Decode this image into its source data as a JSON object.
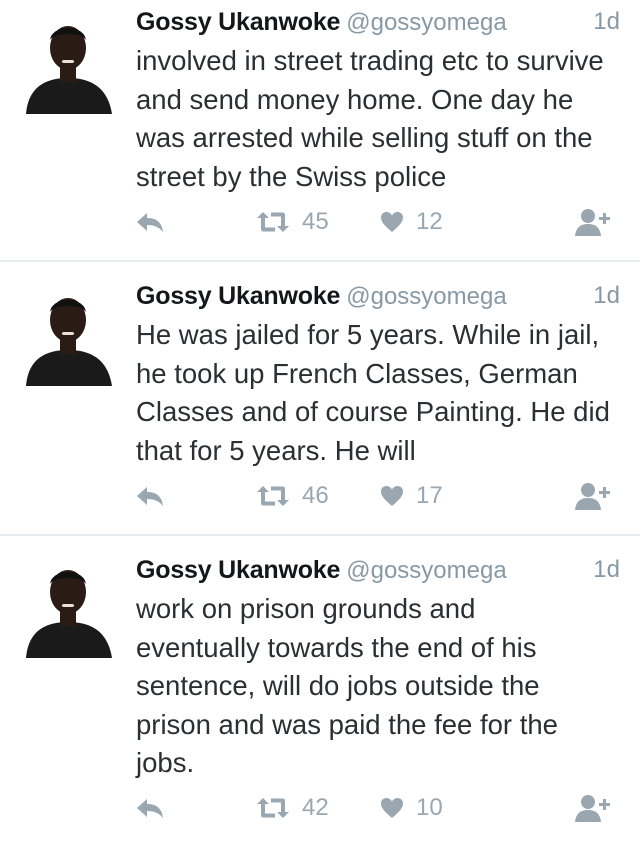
{
  "colors": {
    "name": "#14171a",
    "secondary": "#8899a6",
    "text": "#292f33",
    "icon": "#9aa7b1",
    "divider": "#e6ecf0"
  },
  "icons": {
    "reply": "reply-icon",
    "retweet": "retweet-icon",
    "like": "heart-icon",
    "follow": "follow-user-icon"
  },
  "tweets": [
    {
      "name": "Gossy Ukanwoke",
      "handle": "@gossyomega",
      "time": "1d",
      "lines": [
        "involved in street trading etc to survive",
        "and send money home. One day he",
        "was arrested while selling stuff on the",
        "street by the Swiss police"
      ],
      "retweets": "45",
      "likes": "12"
    },
    {
      "name": "Gossy Ukanwoke",
      "handle": "@gossyomega",
      "time": "1d",
      "lines": [
        "He was jailed for 5 years. While in jail,",
        "he took up French Classes, German",
        "Classes and of course Painting. He did",
        "that for 5 years. He will"
      ],
      "retweets": "46",
      "likes": "17"
    },
    {
      "name": "Gossy Ukanwoke",
      "handle": "@gossyomega",
      "time": "1d",
      "lines": [
        "work on prison grounds and",
        "eventually towards the end of his",
        "sentence, will do jobs outside the",
        "prison and was paid the fee for the",
        "jobs."
      ],
      "retweets": "42",
      "likes": "10"
    }
  ]
}
